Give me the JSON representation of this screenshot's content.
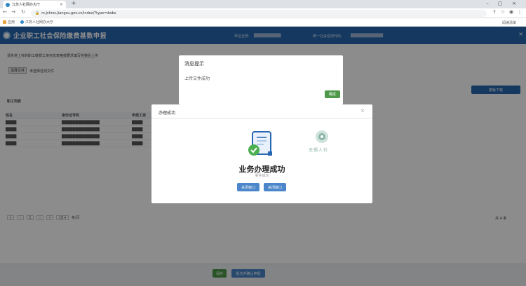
{
  "browser": {
    "tab_title": "江苏人社网办大厅",
    "tab_close": "×",
    "new_tab": "+",
    "url": "rs.jshrss.jiangsu.gov.cn/index/?type=dwbs",
    "bookmarks": [
      {
        "label": "应用"
      },
      {
        "label": "江苏人社网办大厅"
      }
    ],
    "reading_list": "阅读清单",
    "window_controls": [
      "–",
      "▢",
      "×"
    ]
  },
  "app": {
    "title": "企业职工社会保险缴费基数申报",
    "unit_label": "单位全称:",
    "unit_value": "██████████",
    "account_label": "统一社会信用代码:",
    "account_value": "████████████",
    "close_icon": "×"
  },
  "page": {
    "section1_title": "请先将上传的职工缴费工资信息表格按要求填写完整后上传",
    "upload_button": "选择文件",
    "upload_status": "未选择任何文件",
    "import_button": "模板下载",
    "section2_title": "职工列表",
    "table_headers": [
      "姓名",
      "身份证号码",
      "申报工资"
    ],
    "table_rows": [
      [
        "████",
        "██████████████",
        "████"
      ],
      [
        "████",
        "██████████████",
        "████"
      ],
      [
        "████",
        "██████████████",
        "████"
      ],
      [
        "████",
        "██████████████",
        "████"
      ]
    ],
    "pager": [
      "«",
      "‹",
      "1",
      "›",
      "»",
      "10 ▾",
      "条/页"
    ],
    "pager_total": "共 4 条",
    "footer_buttons": [
      {
        "label": "保存",
        "color": "#4e9a4a"
      },
      {
        "label": "提交并确认申报",
        "color": "#4a86c9"
      }
    ]
  },
  "message_box": {
    "title": "消息提示",
    "text": "上传文件成功",
    "ok": "确定"
  },
  "dialog": {
    "title": "办理成功",
    "close": "×",
    "success_title": "业务办理成功",
    "success_sub": "事件成功",
    "buttons": [
      "关闭窗口",
      "关闭窗口"
    ],
    "seal_text": "无锡人社"
  },
  "colors": {
    "app_bar": "#2766b0",
    "success_green": "#4caf50",
    "dialog_button": "#4a86c9"
  }
}
